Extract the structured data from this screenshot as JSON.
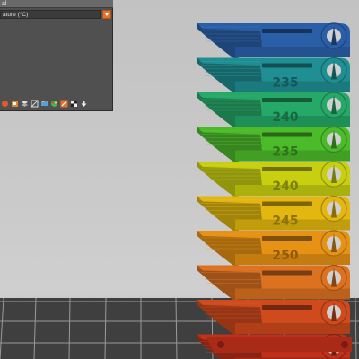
{
  "panel": {
    "title": "al",
    "field_text": "ature (°C)"
  },
  "toolbar": {
    "icons": [
      "tool-red-icon",
      "tool-orange-icon",
      "tool-layers-icon",
      "tool-hatch-icon",
      "tool-paint-icon",
      "tool-palette-icon",
      "tool-scale-icon",
      "tool-cube-icon",
      "tool-arrow-icon"
    ]
  },
  "tower": {
    "segments": [
      {
        "label": "",
        "color": "#2a5fa8"
      },
      {
        "label": "235",
        "color": "#1f8f93"
      },
      {
        "label": "240",
        "color": "#25a868"
      },
      {
        "label": "235",
        "color": "#4cbb2a"
      },
      {
        "label": "240",
        "color": "#c8cf10"
      },
      {
        "label": "245",
        "color": "#e3b70f"
      },
      {
        "label": "250",
        "color": "#e69214"
      },
      {
        "label": "",
        "color": "#dc7220"
      },
      {
        "label": "",
        "color": "#cf4a1c"
      },
      {
        "label": "",
        "color": "#c0301a"
      }
    ]
  }
}
